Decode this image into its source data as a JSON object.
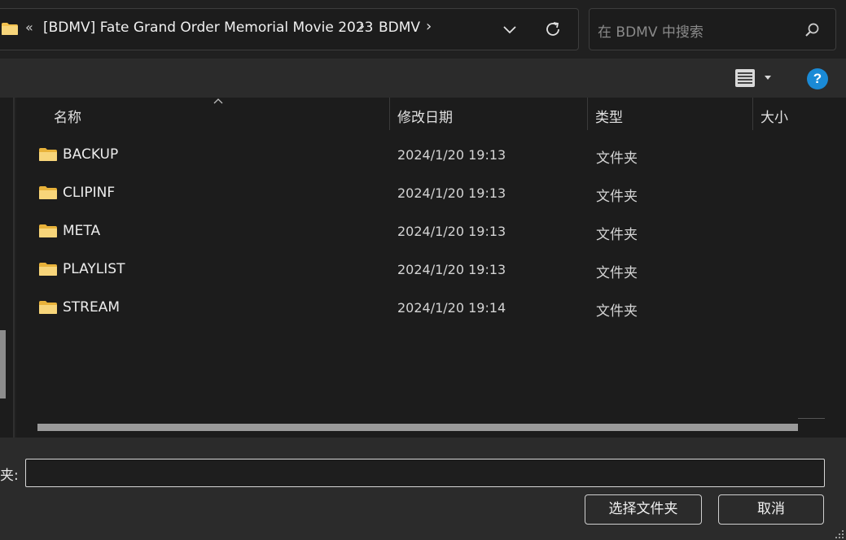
{
  "address_bar": {
    "overflow_chevron": "«",
    "crumbs": [
      "[BDMV] Fate Grand Order Memorial Movie 2023",
      "BDMV"
    ],
    "separator": "›"
  },
  "search": {
    "placeholder": "在 BDMV 中搜索"
  },
  "toolbar": {
    "help_label": "?"
  },
  "columns": {
    "name": "名称",
    "modified": "修改日期",
    "type": "类型",
    "size": "大小"
  },
  "files": [
    {
      "name": "BACKUP",
      "modified": "2024/1/20 19:13",
      "type": "文件夹"
    },
    {
      "name": "CLIPINF",
      "modified": "2024/1/20 19:13",
      "type": "文件夹"
    },
    {
      "name": "META",
      "modified": "2024/1/20 19:13",
      "type": "文件夹"
    },
    {
      "name": "PLAYLIST",
      "modified": "2024/1/20 19:13",
      "type": "文件夹"
    },
    {
      "name": "STREAM",
      "modified": "2024/1/20 19:14",
      "type": "文件夹"
    }
  ],
  "footer": {
    "folder_label": "夹:",
    "folder_value": "",
    "select_button": "选择文件夹",
    "cancel_button": "取消"
  },
  "colors": {
    "folder_icon": "#f2c14e",
    "accent_help": "#1a8ad6",
    "background": "#202020"
  }
}
